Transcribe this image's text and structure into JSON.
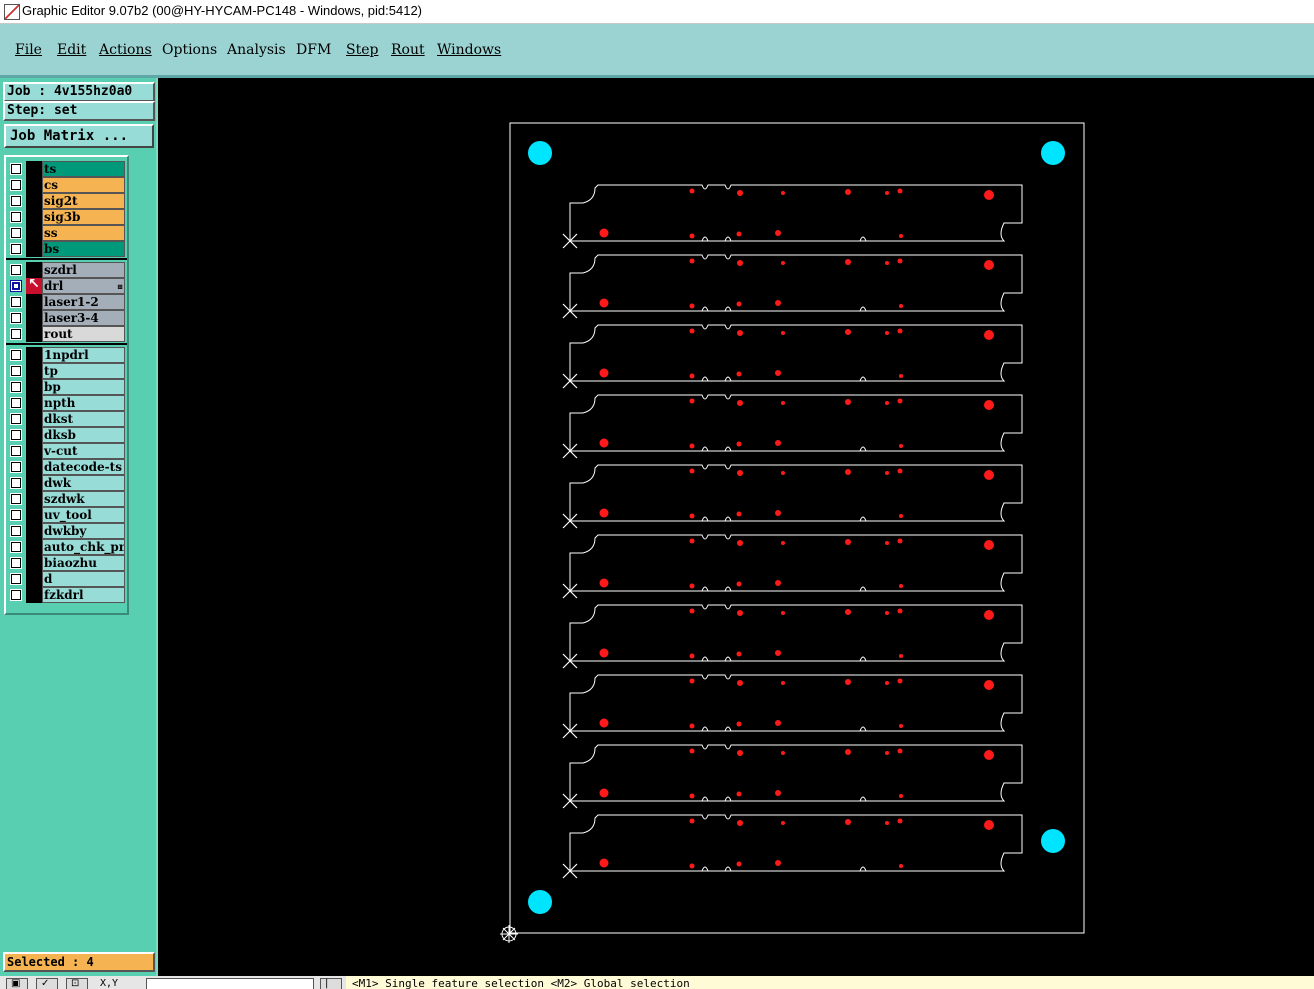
{
  "window": {
    "title": "Graphic Editor 9.07b2 (00@HY-HYCAM-PC148 - Windows, pid:5412)"
  },
  "menu": [
    {
      "label": "File"
    },
    {
      "label": "Edit"
    },
    {
      "label": "Actions"
    },
    {
      "label": "Options"
    },
    {
      "label": "Analysis"
    },
    {
      "label": "DFM"
    },
    {
      "label": "Step"
    },
    {
      "label": "Rout"
    },
    {
      "label": "Windows"
    }
  ],
  "info": {
    "job": "Job : 4v155hz0a0",
    "step": "Step: set"
  },
  "job_matrix_button": "Job Matrix ...",
  "layers": [
    {
      "name": "ts",
      "color": "#009a7a",
      "group": 1
    },
    {
      "name": "cs",
      "color": "#f5b352",
      "group": 1
    },
    {
      "name": "sig2t",
      "color": "#f5b352",
      "group": 1
    },
    {
      "name": "sig3b",
      "color": "#f5b352",
      "group": 1
    },
    {
      "name": "ss",
      "color": "#f5b352",
      "group": 1
    },
    {
      "name": "bs",
      "color": "#009a7a",
      "group": 1
    },
    {
      "name": "szdrl",
      "color": "#a3aeb8",
      "group": 2
    },
    {
      "name": "drl",
      "color": "#a3aeb8",
      "group": 2,
      "active": true,
      "selected_marker": "⊞"
    },
    {
      "name": "laser1-2",
      "color": "#a3aeb8",
      "group": 2
    },
    {
      "name": "laser3-4",
      "color": "#a3aeb8",
      "group": 2
    },
    {
      "name": "rout",
      "color": "#d9d9d9",
      "group": 2
    },
    {
      "name": "1npdrl",
      "color": "#98dcd8",
      "group": 3
    },
    {
      "name": "tp",
      "color": "#98dcd8",
      "group": 3
    },
    {
      "name": "bp",
      "color": "#98dcd8",
      "group": 3
    },
    {
      "name": "npth",
      "color": "#98dcd8",
      "group": 3
    },
    {
      "name": "dkst",
      "color": "#98dcd8",
      "group": 3
    },
    {
      "name": "dksb",
      "color": "#98dcd8",
      "group": 3
    },
    {
      "name": "v-cut",
      "color": "#98dcd8",
      "group": 3
    },
    {
      "name": "datecode-ts",
      "color": "#98dcd8",
      "group": 3
    },
    {
      "name": "dwk",
      "color": "#98dcd8",
      "group": 3
    },
    {
      "name": "szdwk",
      "color": "#98dcd8",
      "group": 3
    },
    {
      "name": "uv_tool",
      "color": "#98dcd8",
      "group": 3
    },
    {
      "name": "dwkby",
      "color": "#98dcd8",
      "group": 3
    },
    {
      "name": "auto_chk_pnl",
      "color": "#98dcd8",
      "group": 3
    },
    {
      "name": "biaozhu",
      "color": "#98dcd8",
      "group": 3
    },
    {
      "name": "d",
      "color": "#98dcd8",
      "group": 3
    },
    {
      "name": "fzkdrl",
      "color": "#98dcd8",
      "group": 3
    }
  ],
  "selected": "Selected : 4",
  "status": {
    "coord_label": "X,Y",
    "message": "<M1> Single feature selection <M2> Global selection"
  },
  "colors": {
    "panel_outline": "#ffffff",
    "fiducial": "#00e5ff",
    "drill": "#ff1a1a"
  },
  "board": {
    "rows": 10
  }
}
